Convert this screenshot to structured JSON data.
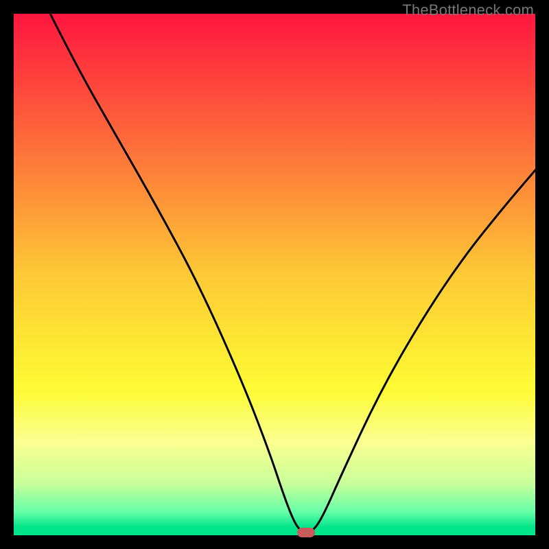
{
  "watermark": "TheBottleneck.com",
  "marker_color": "#c95b5b",
  "chart_data": {
    "type": "line",
    "title": "",
    "xlabel": "",
    "ylabel": "",
    "xlim": [
      0,
      100
    ],
    "ylim": [
      0,
      100
    ],
    "gradient_stops": [
      {
        "offset": 0,
        "color": "#ff163f"
      },
      {
        "offset": 0.25,
        "color": "#fd6d3a"
      },
      {
        "offset": 0.5,
        "color": "#fdc935"
      },
      {
        "offset": 0.72,
        "color": "#fdfb33"
      },
      {
        "offset": 0.82,
        "color": "#fbff8f"
      },
      {
        "offset": 0.9,
        "color": "#c9ff9a"
      },
      {
        "offset": 0.955,
        "color": "#66ffa7"
      },
      {
        "offset": 0.985,
        "color": "#00e48a"
      },
      {
        "offset": 1.0,
        "color": "#00e48a"
      }
    ],
    "series": [
      {
        "name": "bottleneck-curve",
        "x": [
          7,
          12,
          20,
          28,
          36,
          44,
          49,
          52,
          54,
          55.5,
          57,
          59,
          63,
          70,
          78,
          86,
          94,
          100
        ],
        "y": [
          100,
          90,
          76,
          62,
          47,
          29,
          16,
          7,
          2,
          0.5,
          0.5,
          3,
          12,
          27,
          41,
          53,
          63,
          70
        ]
      }
    ],
    "marker": {
      "x": 56,
      "y": 0.5
    },
    "annotations": []
  }
}
